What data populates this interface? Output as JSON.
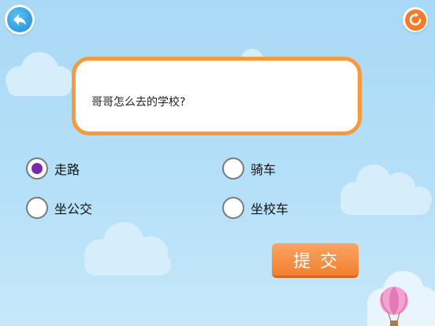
{
  "question": {
    "text": "哥哥怎么去的学校?"
  },
  "options": [
    {
      "label": "走路",
      "selected": true
    },
    {
      "label": "骑车",
      "selected": false
    },
    {
      "label": "坐公交",
      "selected": false
    },
    {
      "label": "坐校车",
      "selected": false
    }
  ],
  "submit": {
    "label": "提交"
  },
  "icons": {
    "back": "back-arrow-icon",
    "refresh": "refresh-icon"
  },
  "colors": {
    "accent": "#f79a3d",
    "sky": "#b6e0f8",
    "selected_dot": "#7a2aa6"
  }
}
